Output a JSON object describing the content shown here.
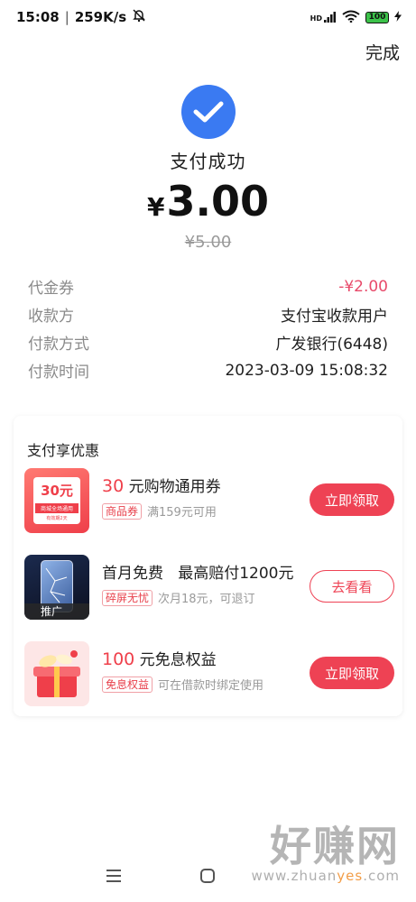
{
  "status_bar": {
    "time": "15:08",
    "speed": "259K/s",
    "network": "HD",
    "battery": "100"
  },
  "header": {
    "done_label": "完成"
  },
  "result": {
    "title": "支付成功",
    "currency": "¥",
    "amount": "3.00",
    "original_amount": "¥5.00"
  },
  "details": [
    {
      "label": "代金券",
      "value": "-¥2.00",
      "color": "#e84a6a"
    },
    {
      "label": "收款方",
      "value": "支付宝收款用户"
    },
    {
      "label": "付款方式",
      "value": "广发银行(6448)"
    },
    {
      "label": "付款时间",
      "value": "2023-03-09 15:08:32"
    }
  ],
  "benefits": {
    "title": "支付享优惠",
    "offers": [
      {
        "title_highlight": "30",
        "title_text": "元购物通用券",
        "tag": "商品券",
        "desc": "满159元可用",
        "button": "立即领取",
        "thumb_amount": "30元",
        "thumb_caption": "商城全场通用",
        "thumb_small": "有效期2天"
      },
      {
        "title_highlight": "",
        "title_text": "首月免费   最高赔付1200元",
        "tag": "碎屏无忧",
        "desc": "次月18元，可退订",
        "button": "去看看",
        "thumb_caption": "推广"
      },
      {
        "title_highlight": "100",
        "title_text": "元免息权益",
        "tag": "免息权益",
        "desc": "可在借款时绑定使用",
        "button": "立即领取"
      }
    ]
  },
  "watermark": {
    "big": "好赚网",
    "site_a": "www.zhuan",
    "site_b": "yes",
    "site_c": ".com"
  },
  "colors": {
    "accent_blue": "#3a7af2",
    "accent_red": "#ee4254"
  }
}
